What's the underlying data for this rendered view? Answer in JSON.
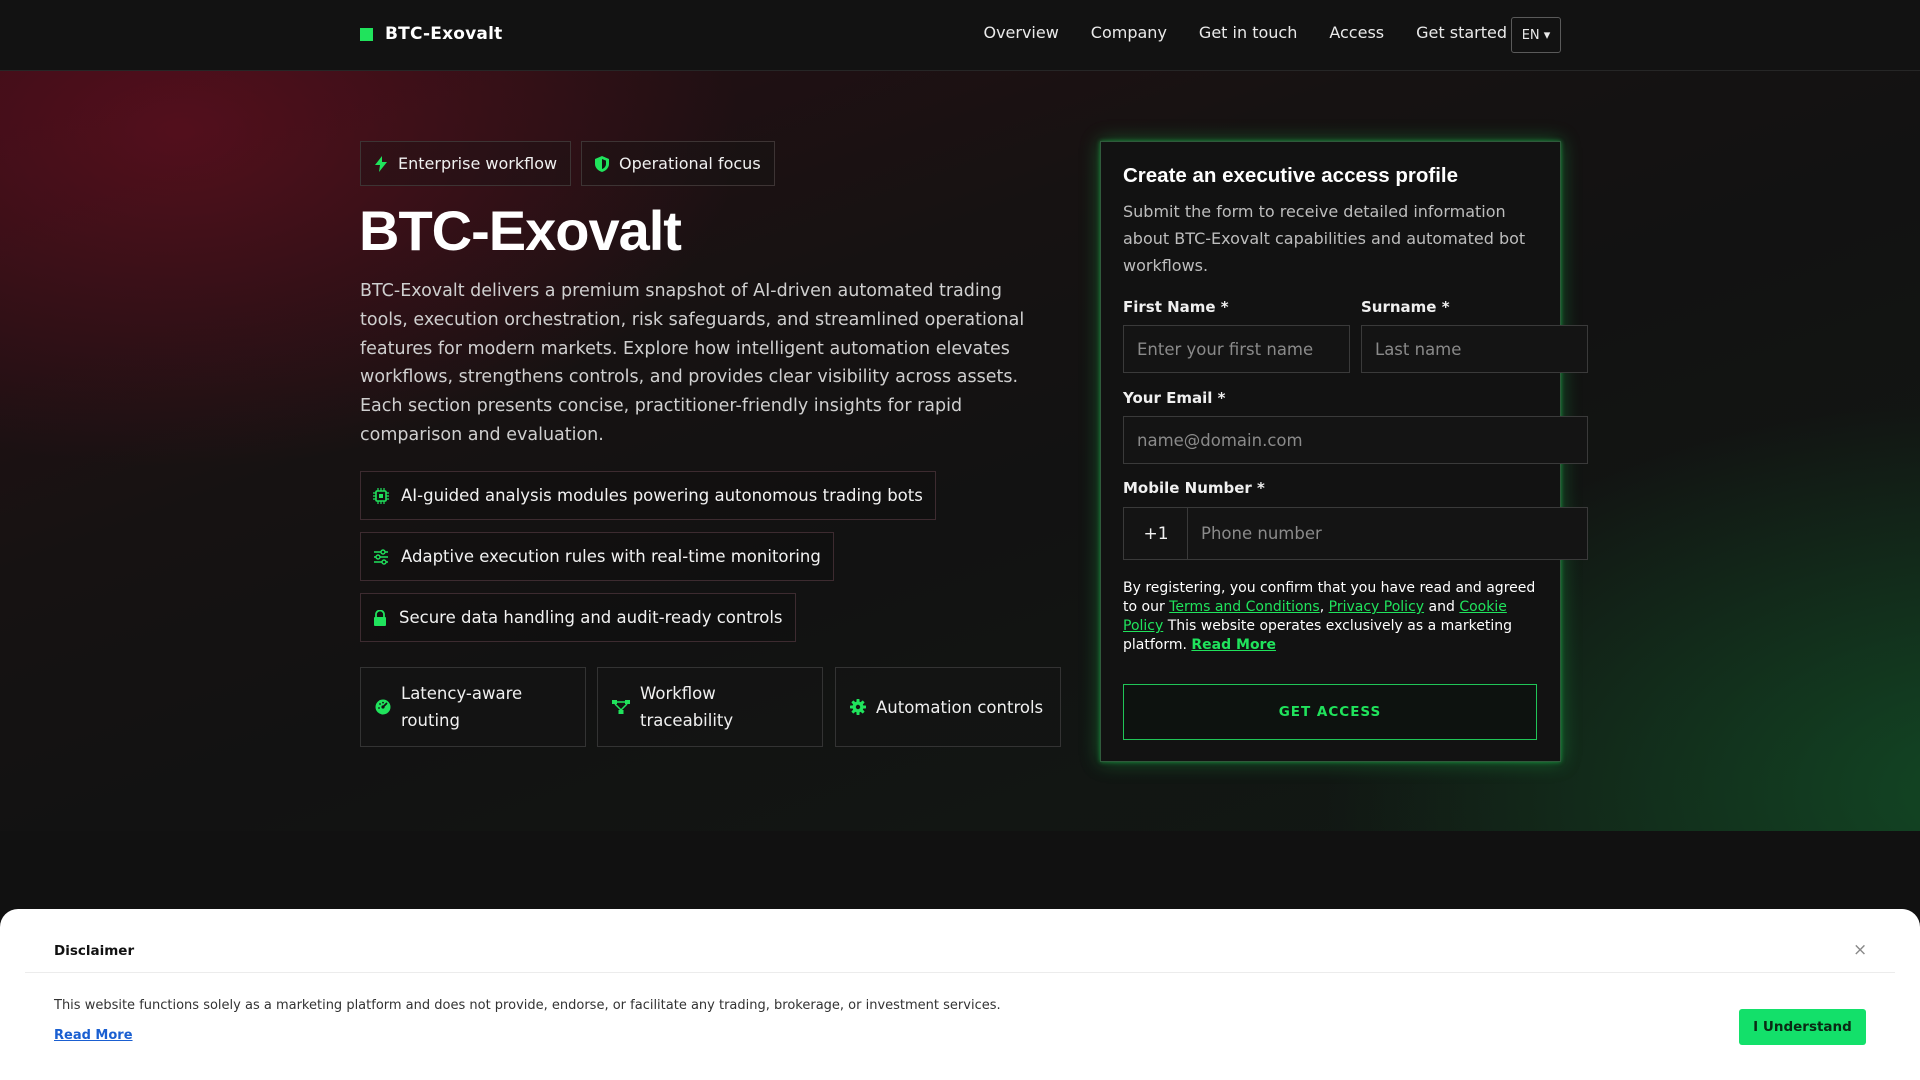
{
  "header": {
    "brand": "BTC-Exovalt",
    "brand_color": "#20e35c",
    "nav": [
      "Overview",
      "Company",
      "Get in touch",
      "Access",
      "Get started"
    ],
    "language": "EN ▾"
  },
  "hero": {
    "tags": [
      {
        "label": "Enterprise workflow",
        "icon": "lightning-icon"
      },
      {
        "label": "Operational focus",
        "icon": "shield-icon"
      }
    ],
    "title": "BTC-Exovalt",
    "lead": "BTC-Exovalt delivers a premium snapshot of AI-driven automated trading tools, execution orchestration, risk safeguards, and streamlined operational features for modern markets. Explore how intelligent automation elevates workflows, strengthens controls, and provides clear visibility across assets. Each section presents concise, practitioner-friendly insights for rapid comparison and evaluation.",
    "features": [
      {
        "label": "AI-guided analysis modules powering autonomous trading bots",
        "icon": "chip-icon"
      },
      {
        "label": "Adaptive execution rules with real-time monitoring",
        "icon": "sliders-icon"
      },
      {
        "label": "Secure data handling and audit-ready controls",
        "icon": "lock-icon"
      }
    ],
    "cards": [
      {
        "label": "Latency-aware routing",
        "icon": "gauge-icon"
      },
      {
        "label": "Workflow traceability",
        "icon": "network-icon"
      },
      {
        "label": "Automation controls",
        "icon": "gear-icon"
      }
    ]
  },
  "form": {
    "title": "Create an executive access profile",
    "subtitle": "Submit the form to receive detailed information about BTC-Exovalt capabilities and automated bot workflows.",
    "first_name_label": "First Name *",
    "first_name_placeholder": "Enter your first name",
    "surname_label": "Surname *",
    "surname_placeholder": "Last name",
    "email_label": "Your Email *",
    "email_placeholder": "name@domain.com",
    "mobile_label": "Mobile Number *",
    "phone_prefix": "+1",
    "phone_placeholder": "Phone number",
    "legal_pre": "By registering, you confirm that you have read and agreed to our ",
    "terms_link": "Terms and Conditions",
    "comma": ", ",
    "privacy_link": "Privacy Policy",
    "and": " and ",
    "cookie_link": "Cookie Policy",
    "legal_post": " This website operates exclusively as a marketing platform. ",
    "read_more": "Read More",
    "submit": "GET ACCESS"
  },
  "disclaimer": {
    "title": "Disclaimer",
    "close": "×",
    "text": "This website functions solely as a marketing platform and does not provide, endorse, or facilitate any trading, brokerage, or investment services.",
    "read_more": "Read More",
    "button": "I Understand",
    "button_color": "#13e06a"
  }
}
